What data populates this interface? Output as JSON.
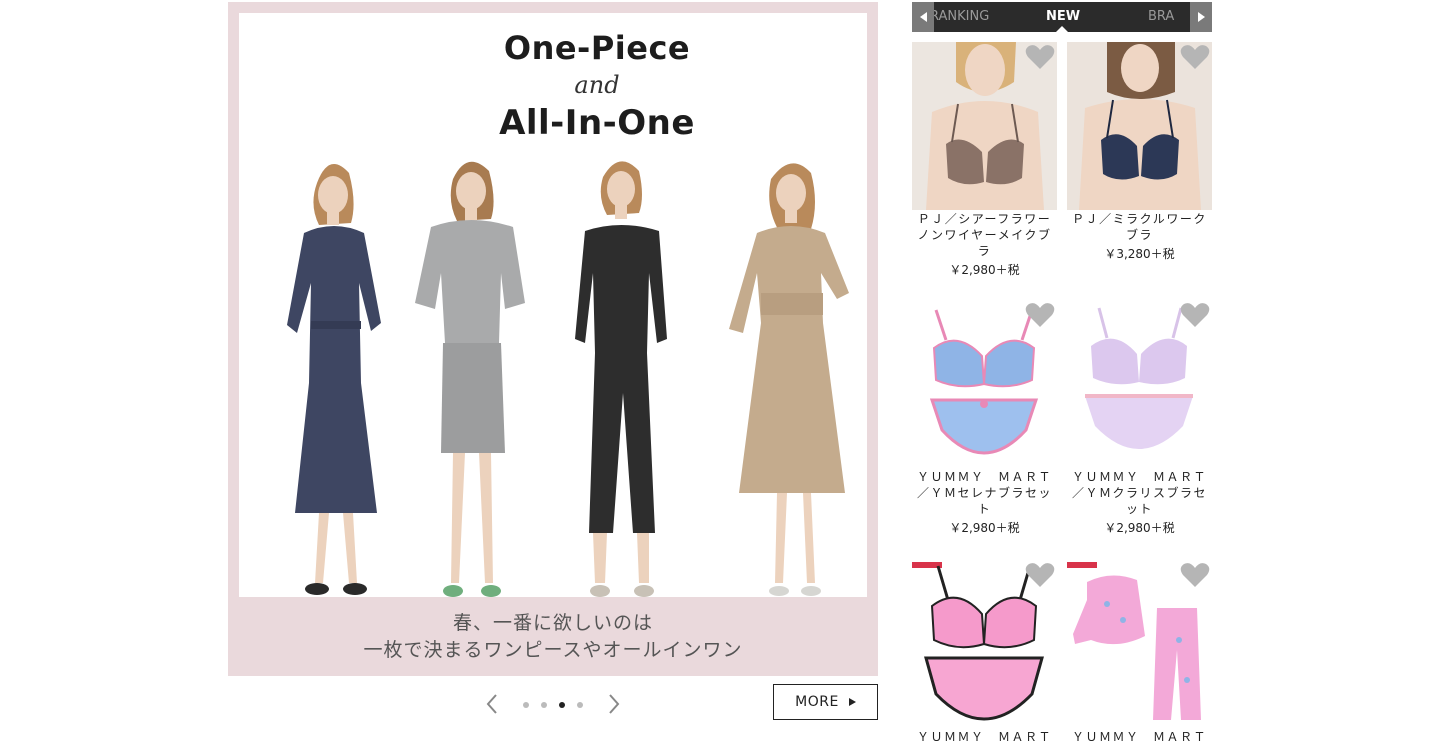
{
  "banner": {
    "title_line1": "One-Piece",
    "title_line2": "and",
    "title_line3": "All-In-One",
    "caption_line1": "春、一番に欲しいのは",
    "caption_line2": "一枚で決まるワンピースやオールインワン",
    "accent_color": "#ead9dc"
  },
  "carousel": {
    "prev_icon": "chevron-left-icon",
    "next_icon": "chevron-right-icon",
    "dot_count": 4,
    "active_dot": 3
  },
  "more": {
    "label": "MORE"
  },
  "tabs": {
    "items": [
      "RANKING",
      "NEW",
      "BRA"
    ],
    "active": "NEW"
  },
  "products": [
    {
      "name_lines": [
        "ＰＪ／シアーフラワー",
        "ノンワイヤーメイクブ",
        "ラ"
      ],
      "price": "￥2,980＋税"
    },
    {
      "name_lines": [
        "ＰＪ／ミラクルワーク",
        "ブラ"
      ],
      "price": "￥3,280＋税"
    },
    {
      "name_lines": [
        "ＹＵＭＭＹ　ＭＡＲＴ",
        "／ＹＭセレナブラセッ",
        "ト"
      ],
      "price": "￥2,980＋税"
    },
    {
      "name_lines": [
        "ＹＵＭＭＹ　ＭＡＲＴ",
        "／ＹＭクラリスブラセ",
        "ット"
      ],
      "price": "￥2,980＋税"
    },
    {
      "name_lines": [
        "ＹＵＭＭＹ　ＭＡＲＴ"
      ],
      "price": ""
    },
    {
      "name_lines": [
        "ＹＵＭＭＹ　ＭＡＲＴ"
      ],
      "price": ""
    }
  ]
}
